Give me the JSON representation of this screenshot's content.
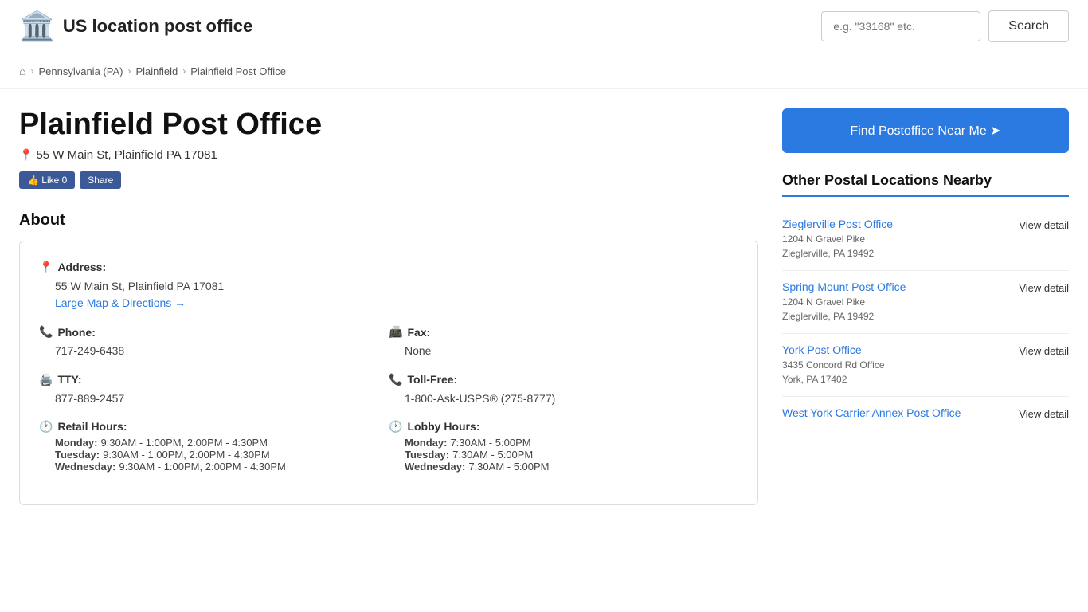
{
  "header": {
    "logo_emoji": "🏛️",
    "title": "US location post office",
    "search_placeholder": "e.g. \"33168\" etc.",
    "search_button_label": "Search"
  },
  "breadcrumb": {
    "home_icon": "⌂",
    "items": [
      {
        "label": "Pennsylvania (PA)",
        "href": "#"
      },
      {
        "label": "Plainfield",
        "href": "#"
      },
      {
        "label": "Plainfield Post Office",
        "href": "#"
      }
    ]
  },
  "page": {
    "title": "Plainfield Post Office",
    "address": "55 W Main St, Plainfield PA 17081",
    "social": {
      "like_label": "👍 Like 0",
      "share_label": "Share"
    },
    "about_title": "About",
    "address_label": "Address:",
    "address_value": "55 W Main St, Plainfield PA 17081",
    "map_link": "Large Map & Directions →",
    "phone_label": "Phone:",
    "phone_value": "717-249-6438",
    "fax_label": "Fax:",
    "fax_value": "None",
    "tty_label": "TTY:",
    "tty_value": "877-889-2457",
    "tollfree_label": "Toll-Free:",
    "tollfree_value": "1-800-Ask-USPS® (275-8777)",
    "retail_hours_label": "Retail Hours:",
    "retail_hours": [
      {
        "day": "Monday:",
        "hours": "9:30AM - 1:00PM, 2:00PM - 4:30PM"
      },
      {
        "day": "Tuesday:",
        "hours": "9:30AM - 1:00PM, 2:00PM - 4:30PM"
      },
      {
        "day": "Wednesday:",
        "hours": "9:30AM - 1:00PM, 2:00PM - 4:30PM"
      }
    ],
    "lobby_hours_label": "Lobby Hours:",
    "lobby_hours": [
      {
        "day": "Monday:",
        "hours": "7:30AM - 5:00PM"
      },
      {
        "day": "Tuesday:",
        "hours": "7:30AM - 5:00PM"
      },
      {
        "day": "Wednesday:",
        "hours": "7:30AM - 5:00PM"
      }
    ]
  },
  "sidebar": {
    "find_button_label": "Find Postoffice Near Me ➤",
    "nearby_title": "Other Postal Locations Nearby",
    "nearby_items": [
      {
        "name": "Zieglerville Post Office",
        "address_line1": "1204 N Gravel Pike",
        "address_line2": "Zieglerville, PA 19492",
        "link_label": "View detail"
      },
      {
        "name": "Spring Mount Post Office",
        "address_line1": "1204 N Gravel Pike",
        "address_line2": "Zieglerville, PA 19492",
        "link_label": "View detail"
      },
      {
        "name": "York Post Office",
        "address_line1": "3435 Concord Rd Office",
        "address_line2": "York, PA 17402",
        "link_label": "View detail"
      },
      {
        "name": "West York Carrier Annex Post Office",
        "address_line1": "",
        "address_line2": "",
        "link_label": "View detail"
      }
    ]
  }
}
